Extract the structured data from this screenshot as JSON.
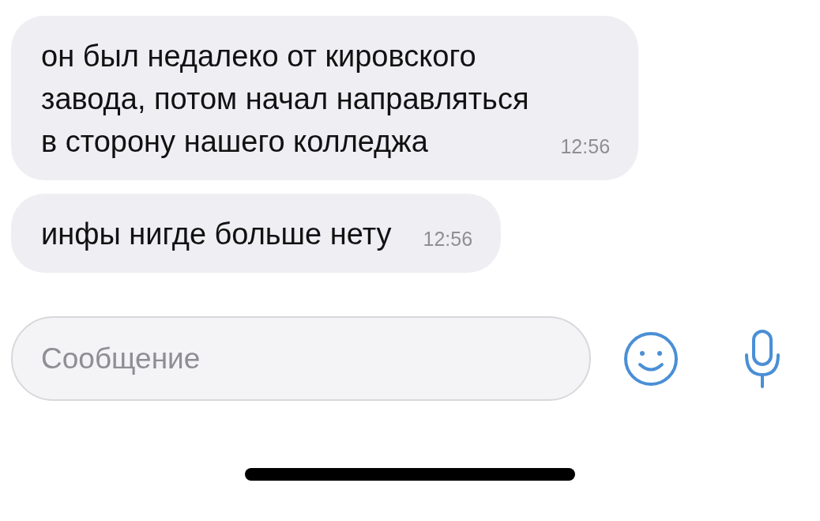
{
  "messages": [
    {
      "lines": [
        "он был недалеко от кировского",
        "завода, потом начал направляться",
        "в сторону нашего колледжа"
      ],
      "time": "12:56"
    },
    {
      "lines": [
        "инфы нигде больше нету"
      ],
      "time": "12:56"
    }
  ],
  "composer": {
    "placeholder": "Сообщение"
  }
}
